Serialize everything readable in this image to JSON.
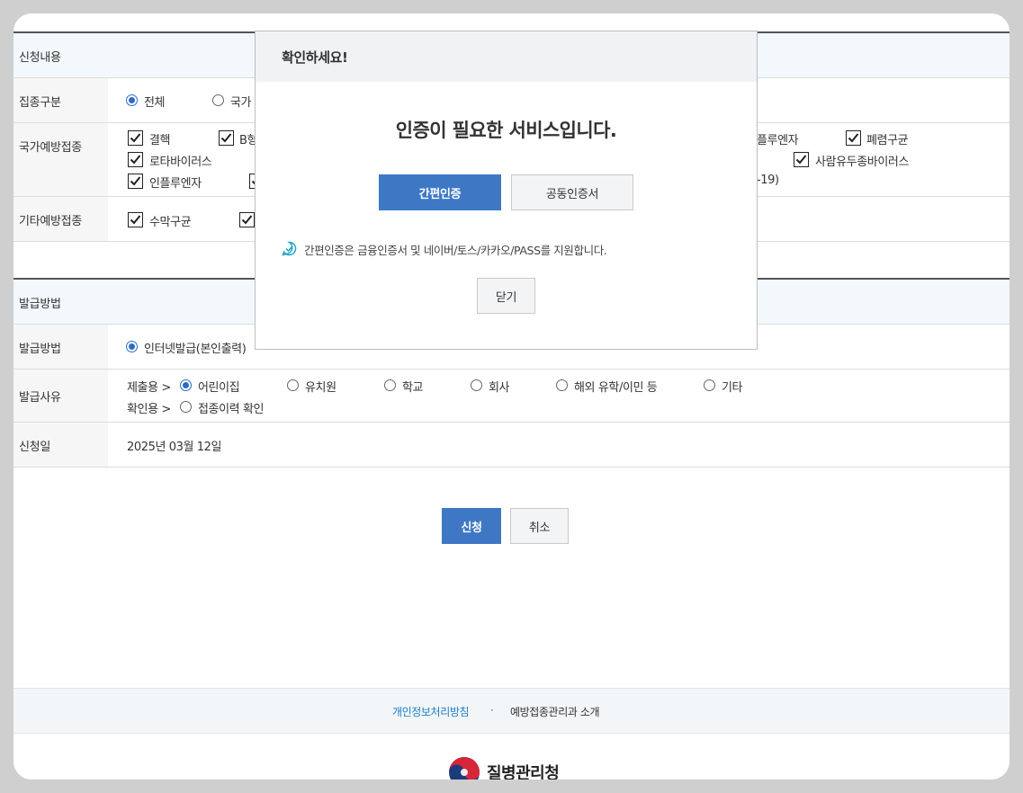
{
  "sections": {
    "application": "신청내용",
    "issue": "발급방법"
  },
  "rows": {
    "vaccine_type": {
      "label": "집종구분",
      "options": [
        "전체",
        "국가"
      ]
    },
    "national_vaccines": {
      "label": "국가예방접종",
      "row1": [
        "결핵",
        "B형",
        "플루엔자",
        "폐렴구균"
      ],
      "row2": [
        "로타바이러스",
        "사람유두종바이러스"
      ],
      "row3": [
        "인플루엔자",
        "-19)"
      ]
    },
    "other_vaccines": {
      "label": "기타예방접종",
      "items": [
        "수막구균"
      ]
    },
    "issue_method": {
      "label": "발급방법",
      "option": "인터넷발급(본인출력)"
    },
    "issue_reason": {
      "label": "발급사유",
      "submit_prefix": "제출용 >",
      "submit_options": [
        "어린이집",
        "유치원",
        "학교",
        "회사",
        "해외 유학/이민 등",
        "기타"
      ],
      "confirm_prefix": "확인용 >",
      "confirm_options": [
        "접종이력 확인"
      ]
    },
    "apply_date": {
      "label": "신청일",
      "value": "2025년 03월 12일"
    }
  },
  "actions": {
    "apply": "신청",
    "cancel": "취소"
  },
  "footer": {
    "privacy": "개인정보처리방침",
    "separator": "·",
    "about": "예방접종관리과 소개",
    "agency": "질병관리청"
  },
  "modal": {
    "title": "확인하세요!",
    "heading": "인증이 필요한 서비스입니다.",
    "simple_auth": "간편인증",
    "cert_auth": "공동인증서",
    "info": "간편인증은 금융인증서 및 네이버/토스/카카오/PASS를 지원합니다.",
    "close": "닫기"
  },
  "colors": {
    "accent": "#3e78c4",
    "link": "#1a7fc4",
    "header_bg": "#f3f8fc"
  }
}
